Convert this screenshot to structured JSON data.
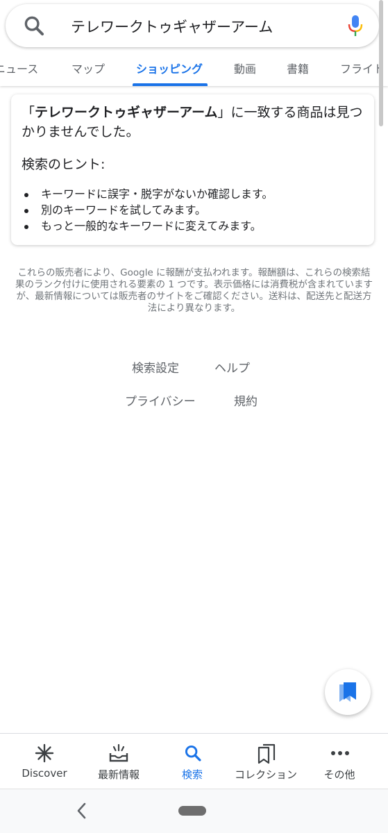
{
  "search": {
    "query": "テレワークトゥギャザーアーム",
    "mic_colors": [
      "#4285f4",
      "#ea4335",
      "#fbbc05",
      "#34a853"
    ]
  },
  "tabs": [
    {
      "label": "ニュース",
      "active": false
    },
    {
      "label": "マップ",
      "active": false
    },
    {
      "label": "ショッピング",
      "active": true
    },
    {
      "label": "動画",
      "active": false
    },
    {
      "label": "書籍",
      "active": false
    },
    {
      "label": "フライト",
      "active": false
    }
  ],
  "result": {
    "title_open": "「",
    "title_query": "テレワークトゥギャザーアーム",
    "title_rest": "」に一致する商品は見つかりませんでした。",
    "tips_heading": "検索のヒント:",
    "tips": [
      "キーワードに誤字・脱字がないか確認します。",
      "別のキーワードを試してみます。",
      "もっと一般的なキーワードに変えてみます。"
    ]
  },
  "disclaimer": "これらの販売者により、Google に報酬が支払われます。報酬額は、これらの検索結果のランク付けに使用される要素の 1 つです。表示価格には消費税が含まれていますが、最新情報については販売者のサイトをご確認ください。送料は、配送先と配送方法により異なります。",
  "footer": {
    "search_settings": "検索設定",
    "help": "ヘルプ",
    "privacy": "プライバシー",
    "terms": "規約"
  },
  "bottom_nav": [
    {
      "label": "Discover",
      "icon": "asterisk-icon",
      "active": false
    },
    {
      "label": "最新情報",
      "icon": "updates-tray-icon",
      "active": false
    },
    {
      "label": "検索",
      "icon": "search-icon",
      "active": true
    },
    {
      "label": "コレクション",
      "icon": "collections-icon",
      "active": false
    },
    {
      "label": "その他",
      "icon": "more-dots-icon",
      "active": false
    }
  ],
  "colors": {
    "accent": "#1a73e8",
    "text": "#202124",
    "secondary_text": "#5f6368"
  }
}
